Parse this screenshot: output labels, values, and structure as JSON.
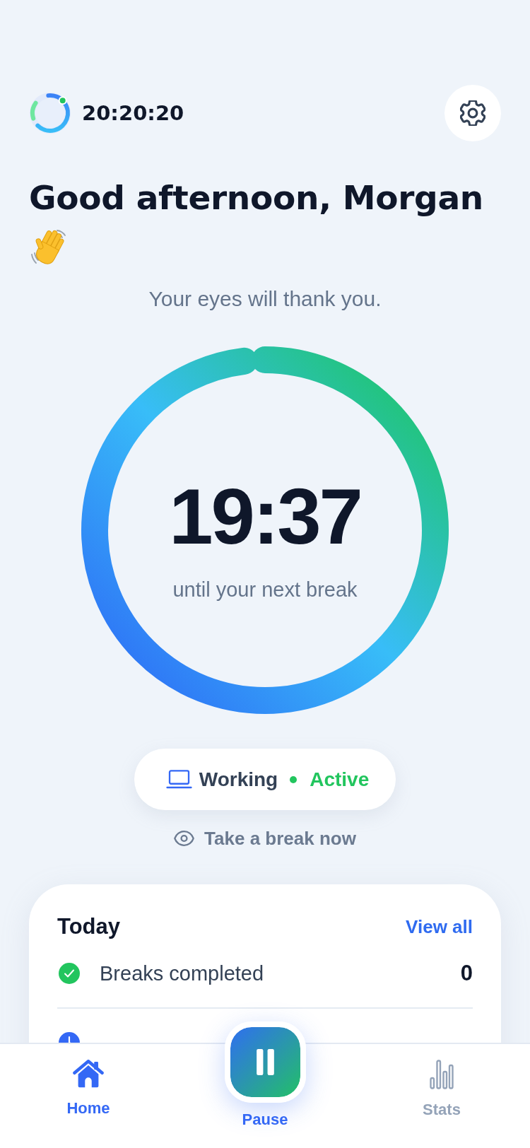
{
  "header": {
    "app_name": "20:20:20"
  },
  "greeting": {
    "title": "Good afternoon, Morgan",
    "subtitle": "Your eyes will thank you."
  },
  "timer": {
    "time": "19:37",
    "caption": "until your next break",
    "level": 0.98
  },
  "status": {
    "mode": "Working",
    "state": "Active",
    "active": true
  },
  "break_link": {
    "label": "Take a break now"
  },
  "today": {
    "title": "Today",
    "link": "View all",
    "rows": [
      {
        "kind": "check",
        "label": "Breaks completed",
        "value": "0"
      },
      {
        "kind": "clock"
      }
    ]
  },
  "tab_bar": {
    "items": [
      {
        "kind": "tab",
        "label": "Home",
        "selected": true
      },
      {
        "kind": "action",
        "label": "Pause"
      },
      {
        "kind": "tab",
        "label": "Stats",
        "selected": false
      }
    ]
  }
}
